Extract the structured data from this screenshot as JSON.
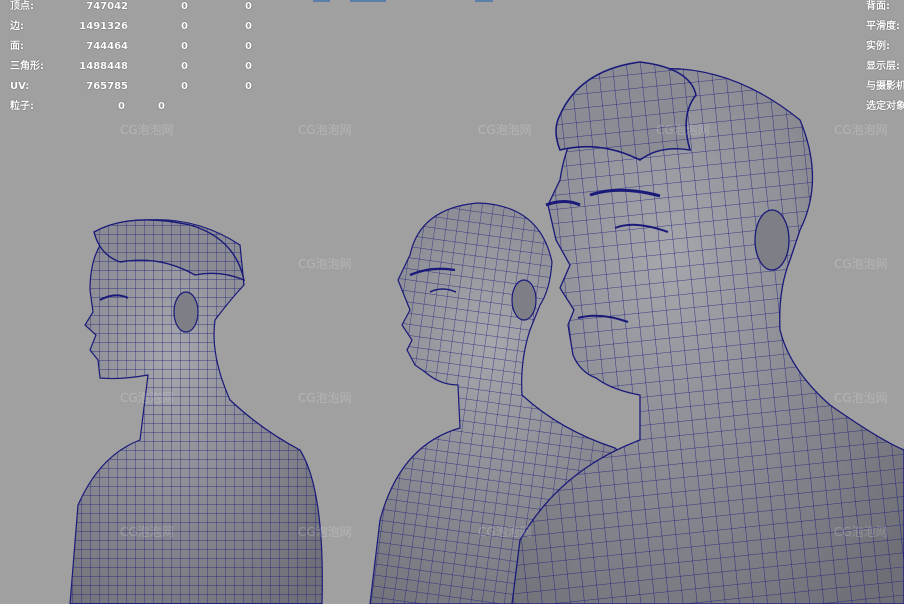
{
  "hud_stats": {
    "rows": [
      {
        "label": "顶点:",
        "value": "747042",
        "c2": "0",
        "c3": "0"
      },
      {
        "label": "边:",
        "value": "1491326",
        "c2": "0",
        "c3": "0"
      },
      {
        "label": "面:",
        "value": "744464",
        "c2": "0",
        "c3": "0"
      },
      {
        "label": "三角形:",
        "value": "1488448",
        "c2": "0",
        "c3": "0"
      },
      {
        "label": "UV:",
        "value": "765785",
        "c2": "0",
        "c3": "0"
      }
    ],
    "particles": {
      "label": "粒子:",
      "v1": "0",
      "v2": "0"
    }
  },
  "hud_display": {
    "rows": [
      "背面:",
      "平滑度:",
      "实例:",
      "显示层:",
      "与摄影机",
      "选定对象"
    ]
  },
  "watermark": "CG泡泡网",
  "colors": {
    "background": "#a0a0a0",
    "wireframe": "#1a1a7a",
    "skin": "#8e8e94"
  }
}
